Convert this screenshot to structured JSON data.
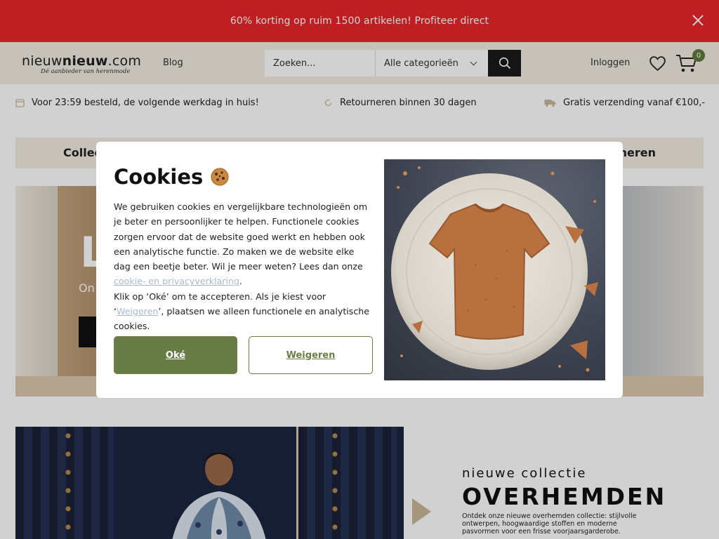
{
  "promo": {
    "text": "60% korting op ruim 1500 artikelen! Profiteer direct"
  },
  "header": {
    "logo_main_prefix": "nieuw",
    "logo_main_bold": "nieuw",
    "logo_main_suffix": ".com",
    "logo_tagline": "Dé aanbieder van herenmode",
    "blog_label": "Blog",
    "search_placeholder": "Zoeken...",
    "category_select": "Alle categorieën",
    "login_label": "Inloggen",
    "cart_count": "0"
  },
  "usp": [
    {
      "icon": "calendar-icon",
      "text": "Voor 23:59 besteld, de volgende werkdag in huis!"
    },
    {
      "icon": "refresh-icon",
      "text": "Retourneren binnen 30 dagen"
    },
    {
      "icon": "truck-icon",
      "text": "Gratis verzending vanaf €100,-"
    }
  ],
  "category_nav": {
    "left": "Collec",
    "right": "neren"
  },
  "hero": {
    "title": "L",
    "subtitle": "On"
  },
  "collection": {
    "small": "nieuwe collectie",
    "big": "OVERHEMDEN",
    "desc": "Ontdek onze nieuwe overhemden collectie: stijlvolle ontwerpen, hoogwaardige stoffen en moderne pasvormen voor een frisse voorjaarsgarderobe."
  },
  "cookie": {
    "title": "Cookies",
    "text_before_link": "We gebruiken cookies en vergelijkbare technologieën om je beter en persoonlijker te helpen. Functionele cookies zorgen ervoor dat de website goed werkt en hebben ook een analytische functie. Zo maken we de website elke dag een beetje beter. Wil je meer weten? Lees dan onze ",
    "link_label": "cookie- en privacyverklaring",
    "text_after_link": ".",
    "line2_before": "Klik op ‘Oké’ om te accepteren. Als je kiest voor ‘",
    "line2_link": "Weigeren",
    "line2_after": "’, plaatsen we alleen functionele en analytische cookies.",
    "accept_label": "Oké",
    "decline_label": "Weigeren"
  },
  "colors": {
    "promo_bar": "#e8262b",
    "header_bg": "#f2ece2",
    "accent_green": "#6a7c45",
    "search_button": "#1a1a1a"
  }
}
